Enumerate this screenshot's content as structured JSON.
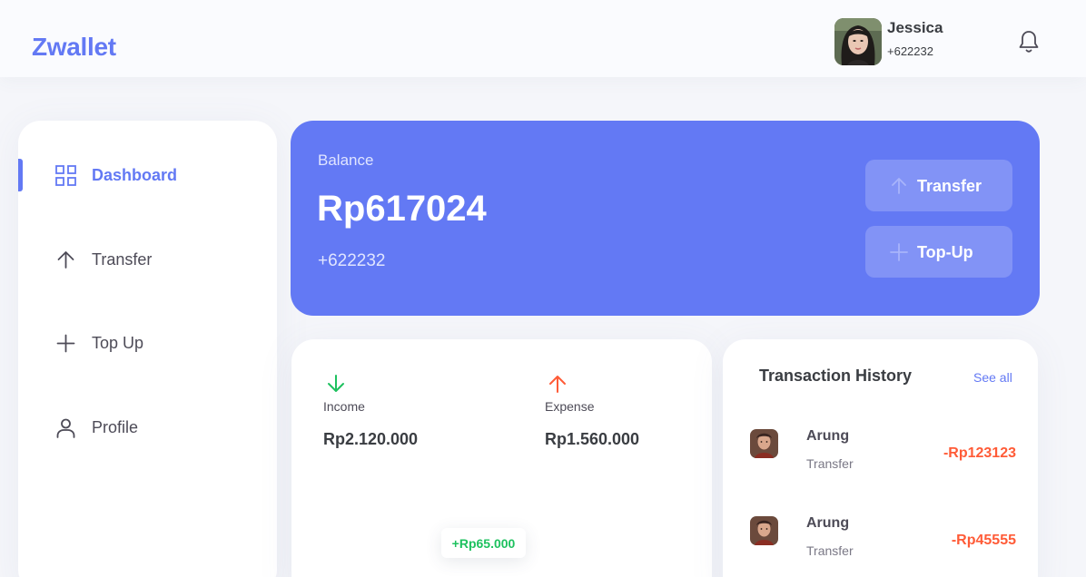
{
  "header": {
    "logo": "Zwallet",
    "user_name": "Jessica",
    "user_phone": "+622232"
  },
  "sidebar": {
    "items": [
      {
        "label": "Dashboard",
        "icon": "grid-icon",
        "active": true
      },
      {
        "label": "Transfer",
        "icon": "arrow-up-icon",
        "active": false
      },
      {
        "label": "Top Up",
        "icon": "plus-icon",
        "active": false
      },
      {
        "label": "Profile",
        "icon": "user-icon",
        "active": false
      }
    ]
  },
  "balance": {
    "label": "Balance",
    "amount": "Rp617024",
    "phone": "+622232",
    "transfer_label": "Transfer",
    "topup_label": "Top-Up"
  },
  "stats": {
    "income_label": "Income",
    "income_value": "Rp2.120.000",
    "expense_label": "Expense",
    "expense_value": "Rp1.560.000",
    "chart_tooltip": "+Rp65.000"
  },
  "history": {
    "title": "Transaction History",
    "see_all": "See all",
    "transactions": [
      {
        "name": "Arung",
        "type": "Transfer",
        "amount": "-Rp123123"
      },
      {
        "name": "Arung",
        "type": "Transfer",
        "amount": "-Rp45555"
      }
    ]
  },
  "colors": {
    "primary": "#6379f4",
    "income": "#1ec15f",
    "expense": "#ff5b37"
  }
}
